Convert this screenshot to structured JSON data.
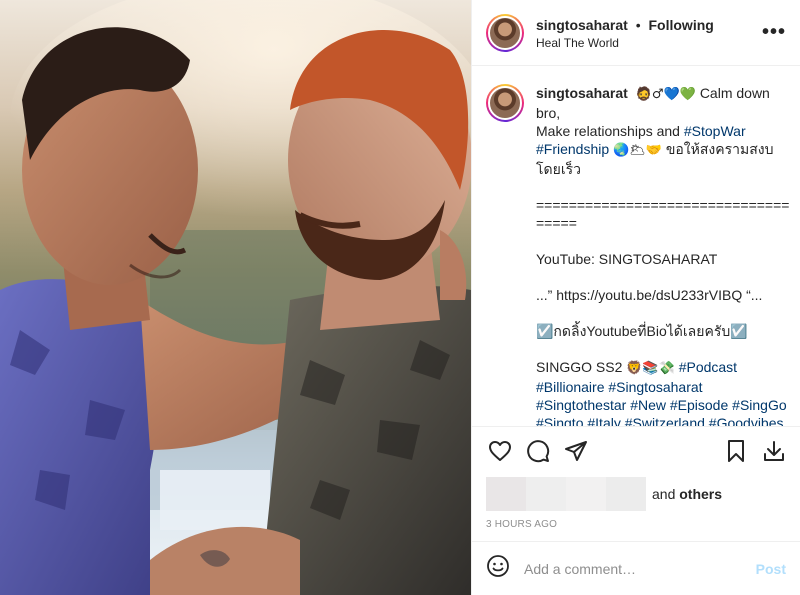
{
  "colors": {
    "link": "#00376b",
    "muted": "#8e8e8e",
    "post_disabled": "#b2dffc",
    "border": "#efefef"
  },
  "header": {
    "username": "singtosaharat",
    "separator": "•",
    "follow_status": "Following",
    "location": "Heal The World",
    "more_icon": "ellipsis-icon",
    "more_label": "•••"
  },
  "caption": {
    "username": "singtosaharat",
    "emojis_1": "🧔♂💙💚",
    "line1": "Calm down bro,",
    "line2_prefix": "Make relationships and",
    "tag_stopwar": "#StopWar",
    "tag_friendship": "#Friendship",
    "emojis_2": "🌏🌥🤝",
    "thai_text": "ขอให้สงครามสงบโดยเร็ว",
    "separator_line": "====================================",
    "youtube_line": "YouTube: SINGTOSAHARAT",
    "link_line": "...” https://youtu.be/dsU233rVIBQ “...",
    "bio_line": "☑️กดลิ้งYoutubeที่Bioได้เลยครับ☑️",
    "singgo_prefix": "SINGGO SS2",
    "emojis_3": "🦁📚💸",
    "tags": [
      "#Podcast",
      "#Billionaire",
      "#Singtosaharat",
      "#Singtothestar",
      "#New",
      "#Episode",
      "#SingGo",
      "#Singto",
      "#Italy",
      "#Switzerland",
      "#Goodvibes"
    ]
  },
  "actions": {
    "like_icon": "heart-icon",
    "comment_icon": "comment-bubble-icon",
    "share_icon": "paper-plane-icon",
    "save_icon": "bookmark-icon",
    "download_icon": "download-icon"
  },
  "likes": {
    "prefix": "and",
    "suffix": "others"
  },
  "timestamp": "3 HOURS AGO",
  "comment": {
    "emoji_icon": "smiley-icon",
    "placeholder": "Add a comment…",
    "post_label": "Post"
  }
}
